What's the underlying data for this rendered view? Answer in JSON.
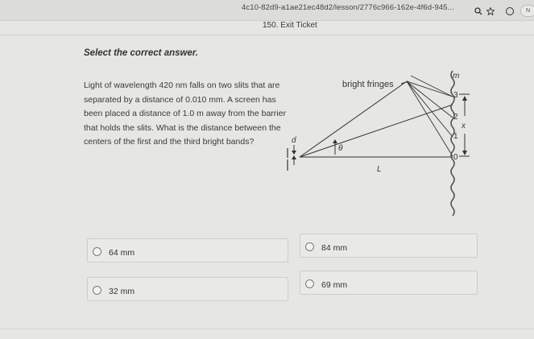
{
  "browser": {
    "url": "4c10-82d9-a1ae21ec48d2/lesson/2776c966-162e-4f6d-945...",
    "avatar_text": "N"
  },
  "header": {
    "title": "150. Exit Ticket"
  },
  "question": {
    "instruction": "Select the correct answer.",
    "text": "Light of wavelength 420 nm falls on two slits that are separated by a distance of 0.010 mm. A screen has been placed a distance of 1.0 m away from the barrier that holds the slits. What is the distance between the centers of the first and the third bright bands?"
  },
  "diagram": {
    "bright_fringes_label": "bright fringes",
    "m_label": "m",
    "d_label": "d",
    "theta_label": "θ",
    "L_label": "L",
    "x_label": "x",
    "fringe_numbers": [
      "3",
      "2",
      "1",
      "0"
    ]
  },
  "options": [
    {
      "label": "64 mm"
    },
    {
      "label": "84 mm"
    },
    {
      "label": "32 mm"
    },
    {
      "label": "69 mm"
    }
  ]
}
